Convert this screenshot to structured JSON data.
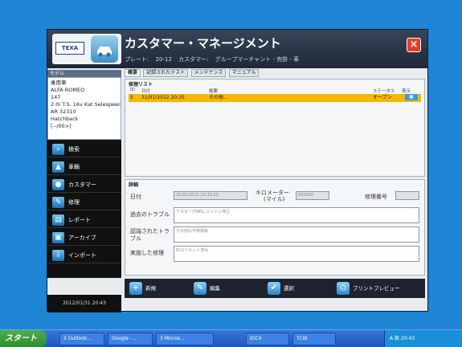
{
  "window": {
    "title": "カスタマー・マネージメント",
    "close_icon": "×",
    "info": {
      "plate_label": "プレート:",
      "plate_value": "20-12",
      "customer_label": "カスタマー:",
      "customer_value": "グループマーチャント - 売掛 - 車"
    }
  },
  "logo": {
    "brand": "TEXA",
    "icon": "car-icon"
  },
  "tabs": [
    "概要",
    "記録されたテスト",
    "メンテナンス",
    "マニュアル"
  ],
  "model": {
    "header": "モデル",
    "lines": [
      "乗用車",
      "ALFA ROMEO",
      "147",
      "2.0i T.S. 16v Kat Selespeed",
      "AR 32310",
      "Hatchback",
      "[--/00>]"
    ]
  },
  "nav": [
    {
      "label": "検索",
      "icon": "search-icon",
      "glyph": "⌕"
    },
    {
      "label": "車輌",
      "icon": "car-icon",
      "glyph": "▲"
    },
    {
      "label": "カスタマー",
      "icon": "customer-icon",
      "glyph": "●"
    },
    {
      "label": "修理",
      "icon": "repair-icon",
      "glyph": "✎"
    },
    {
      "label": "レポート",
      "icon": "report-icon",
      "glyph": "▤"
    },
    {
      "label": "アーカイブ",
      "icon": "archive-icon",
      "glyph": "▣"
    },
    {
      "label": "インポート",
      "icon": "import-icon",
      "glyph": "⇩"
    }
  ],
  "datetime": "2012/01/31 20:43",
  "repair_list": {
    "title": "修理リスト",
    "columns": [
      "ID",
      "日付",
      "概要",
      "ステータス",
      "表示"
    ],
    "rows": [
      {
        "id": "5",
        "date": "31/01/2012 20:35",
        "summary": "その他...",
        "status": "オープン",
        "action_icon": "view-icon"
      }
    ]
  },
  "details": {
    "title": "詳細",
    "date_label": "日付",
    "date_value": "31/01/2012 20:35:23",
    "km_label": "キロメーター",
    "km_sub": "(マイル)",
    "km_value": "000000",
    "repair_no_label": "修理番号",
    "trouble_label": "過去のトラブル",
    "trouble_value": "テスター/TMRにエンジン停止",
    "recognized_label": "認識されたトラブル",
    "recognized_value": "その他の不明項目",
    "performed_label": "実施した修理",
    "performed_value": "ECUリセット済み"
  },
  "actions": [
    {
      "label": "新規",
      "icon": "new-icon",
      "glyph": "+"
    },
    {
      "label": "編集",
      "icon": "edit-icon",
      "glyph": "✎"
    },
    {
      "label": "選択",
      "icon": "select-icon",
      "glyph": "✔"
    },
    {
      "label": "プリントプレビュー",
      "icon": "print-preview-icon",
      "glyph": "⎙"
    }
  ],
  "taskbar": {
    "start": "スタート",
    "tasks": [
      "2 Outlook...",
      "Google -...",
      "3 Micros...",
      "IDC4",
      "TCW"
    ],
    "tray": "A 般 20:43"
  }
}
